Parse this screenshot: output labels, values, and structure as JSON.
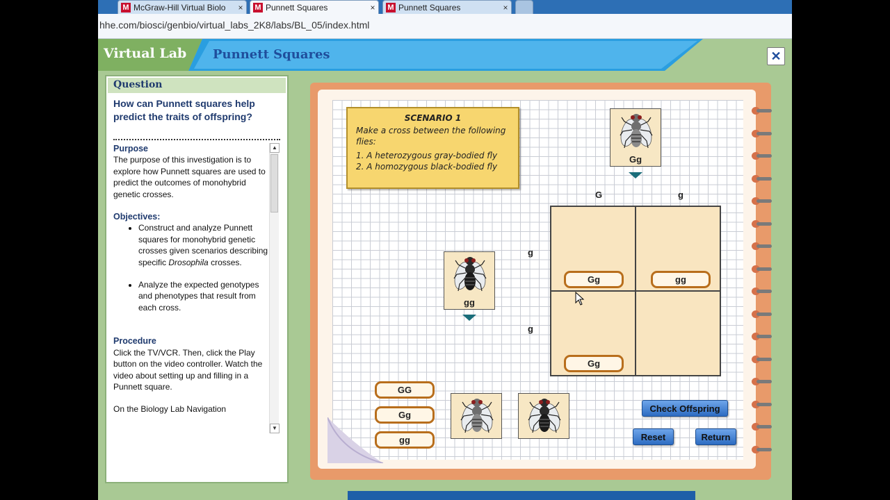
{
  "browser": {
    "tabs": [
      {
        "label": "McGraw-Hill Virtual Biolo",
        "active": false
      },
      {
        "label": "Punnett Squares",
        "active": true
      },
      {
        "label": "Punnett Squares",
        "active": false
      }
    ],
    "favicon_letter": "M",
    "close_glyph": "×",
    "address": "hhe.com/biosci/genbio/virtual_labs_2K8/labs/BL_05/index.html"
  },
  "header": {
    "brand": "Virtual Lab",
    "title": "Punnett Squares",
    "close_glyph": "✕"
  },
  "question_panel": {
    "label": "Question",
    "question": "How can Punnett squares help predict the traits of offspring?",
    "purpose_heading": "Purpose",
    "purpose_text": "The purpose of this investigation is to explore how Punnett squares are used to predict the outcomes of monohybrid genetic crosses.",
    "objectives_heading": "Objectives:",
    "objective_1_prefix": "Construct and analyze Punnett squares for monohybrid genetic crosses given scenarios describing specific ",
    "objective_1_italic": "Drosophila",
    "objective_1_suffix": " crosses.",
    "objective_2": "Analyze the expected genotypes and phenotypes that result from each cross.",
    "procedure_heading": "Procedure",
    "procedure_text": "Click the TV/VCR. Then, click the Play button on the video controller. Watch the video about setting up and filling in a Punnett square.",
    "procedure_text_2": "On the Biology Lab Navigation"
  },
  "scenario": {
    "title": "SCENARIO 1",
    "line1": "Make a cross between the following flies:",
    "item1": "1. A heterozygous gray-bodied fly",
    "item2": "2. A homozygous black-bodied fly"
  },
  "parent_top": {
    "genotype": "Gg",
    "body_color": "gray"
  },
  "parent_left": {
    "genotype": "gg",
    "body_color": "black"
  },
  "alleles": {
    "top_left": "G",
    "top_right": "g",
    "left_top": "g",
    "left_bottom": "g"
  },
  "punnett_cells": {
    "top_left": "Gg",
    "top_right": "gg",
    "bottom_left": "Gg",
    "bottom_right": ""
  },
  "genotype_chips": [
    "GG",
    "Gg",
    "gg"
  ],
  "buttons": {
    "check": "Check Offspring",
    "reset": "Reset",
    "return": "Return"
  }
}
